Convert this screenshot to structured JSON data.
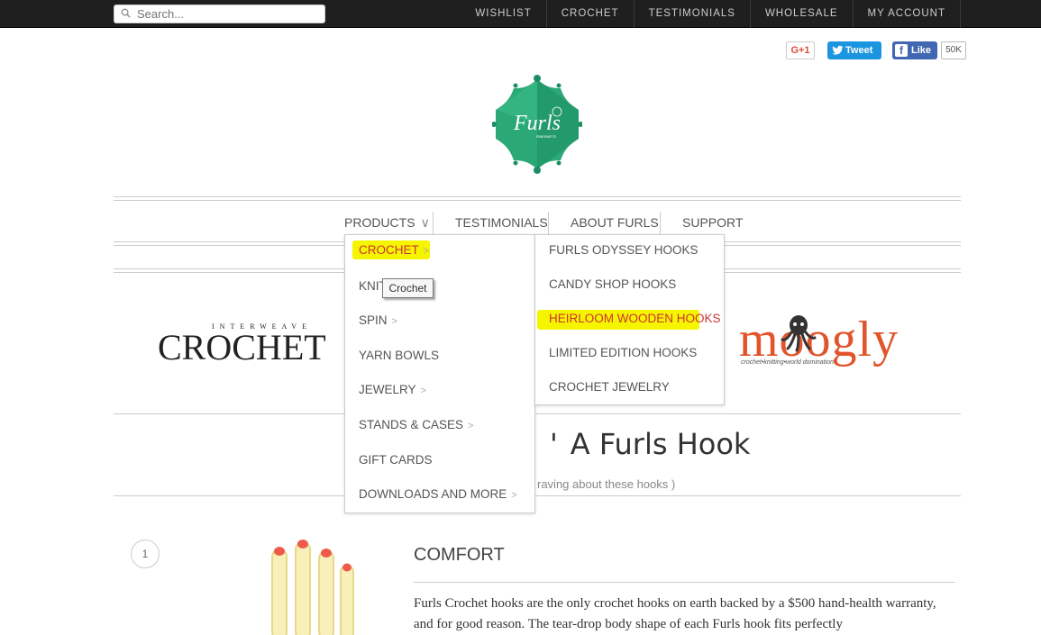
{
  "search": {
    "placeholder": "Search..."
  },
  "top_nav": [
    "WISHLIST",
    "CROCHET",
    "TESTIMONIALS",
    "WHOLESALE",
    "MY ACCOUNT"
  ],
  "social": {
    "gplus": "G+1",
    "tweet": "Tweet",
    "fb_like": "Like",
    "fb_count": "50K"
  },
  "logo": {
    "text": "Furls",
    "subtext": "FIBERARTS"
  },
  "main_nav": {
    "products": "PRODUCTS",
    "testimonials": "TESTIMONIALS",
    "about": "ABOUT FURLS",
    "support": "SUPPORT"
  },
  "dropdown": {
    "items": [
      {
        "label": "CROCHET",
        "arrow": ">"
      },
      {
        "label": "KNIT",
        "arrow": ""
      },
      {
        "label": "SPIN",
        "arrow": ">"
      },
      {
        "label": "YARN BOWLS",
        "arrow": ""
      },
      {
        "label": "JEWELRY",
        "arrow": ">"
      },
      {
        "label": "STANDS & CASES",
        "arrow": ">"
      },
      {
        "label": "GIFT CARDS",
        "arrow": ""
      },
      {
        "label": "DOWNLOADS AND MORE",
        "arrow": ">"
      }
    ],
    "submenu": [
      "FURLS ODYSSEY HOOKS",
      "CANDY SHOP HOOKS",
      "HEIRLOOM WOODEN HOOKS",
      "LIMITED EDITION HOOKS",
      "CROCHET JEWELRY"
    ],
    "tooltip": "Crochet"
  },
  "press": {
    "crochet_small": "INTERWEAVE",
    "crochet_big": "CROCHET",
    "moogly": "moogly",
    "moogly_tag": "crochet•knitting•world domination"
  },
  "section": {
    "heading_partial": "A Furls Hook",
    "subheading_partial": "raving about these hooks )"
  },
  "feature": {
    "number": "1",
    "title": "COMFORT",
    "text": "Furls Crochet hooks are the only crochet hooks on earth backed by a $500 hand-health warranty, and for good reason. The tear-drop body shape of each Furls hook fits perfectly"
  },
  "colors": {
    "topbar": "#1f1f1f",
    "highlight": "#f6f500",
    "accent_red": "#e2552c",
    "logo_green": "#2aa876"
  }
}
